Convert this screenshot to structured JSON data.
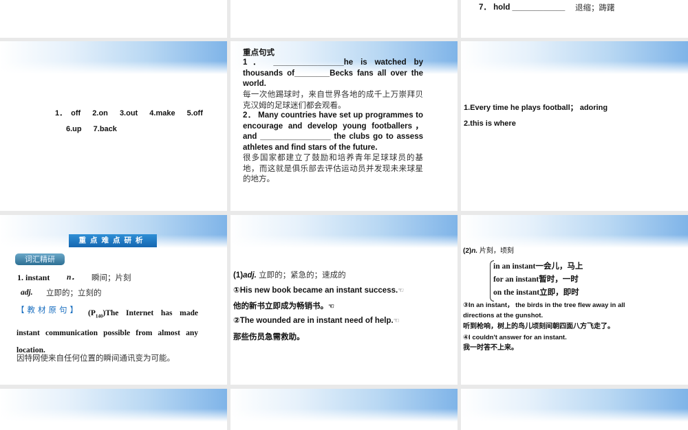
{
  "slide_r0c3": {
    "line": "7． hold ____________",
    "cn": "退缩；踌躇"
  },
  "slide_r1c1": {
    "line1": "1． off　 2.on　 3.out　 4.make　 5.off",
    "line2": "6.up　 7.back"
  },
  "slide_r1c2": {
    "title": "重点句式",
    "s1_en": "1． ________________he is watched by thousands of________Becks fans all over the world.",
    "s1_cn": "每一次他踢球时，来自世界各地的成千上万崇拜贝克汉姆的足球迷们都会观看。",
    "s2_en": "2． Many countries have set up programmes to encourage and develop young footballers， and ________________ the clubs go to assess athletes and find stars of the future.",
    "s2_cn": "很多国家都建立了鼓励和培养青年足球球员的基地，而这就是俱乐部去评估运动员并发现未来球星的地方。"
  },
  "slide_r1c3": {
    "a1": "1.Every time he plays football； adoring",
    "a2": "2.this is where"
  },
  "slide_r2c1": {
    "band": "重点难点研析",
    "tag": "词汇精研",
    "word": "1. instant",
    "pos_n": "n．",
    "mean_n": "瞬间；片刻",
    "pos_adj": "adj.",
    "mean_adj": "立即的；立刻的",
    "src_label": "【教材原句】",
    "src_ref": "(P",
    "src_sub": "140",
    "src_en": ")The Internet has made instant communication possible from almost any location.",
    "src_cn": "因特网使来自任何位置的瞬间通讯变为可能。"
  },
  "slide_r2c2": {
    "head_num": "(1)",
    "head_pos": "adj.",
    "head_cn": "立即的；紧急的；速成的",
    "e1": "①His new book became an instant success.",
    "e1_cn": "他的新书立即成为畅销书。",
    "e2": "②The wounded are in instant need of help.",
    "e2_cn": "那些伤员急需救助。"
  },
  "slide_r2c3": {
    "head_num": "(2)",
    "head_pos": "n.",
    "head_cn": "片刻，顷刻",
    "p1": "in an instant一会儿，马上",
    "p2": "for an instant暂时，一时",
    "p3": "on the instant立即，即时",
    "e3": "③In an instant， the birds in the tree flew away in all directions at the gunshot.",
    "e3_cn": "听到枪响，树上的鸟儿顷刻间朝四面八方飞走了。",
    "e4": "④I couldn't answer for an instant.",
    "e4_cn": "我一时答不上来。"
  }
}
